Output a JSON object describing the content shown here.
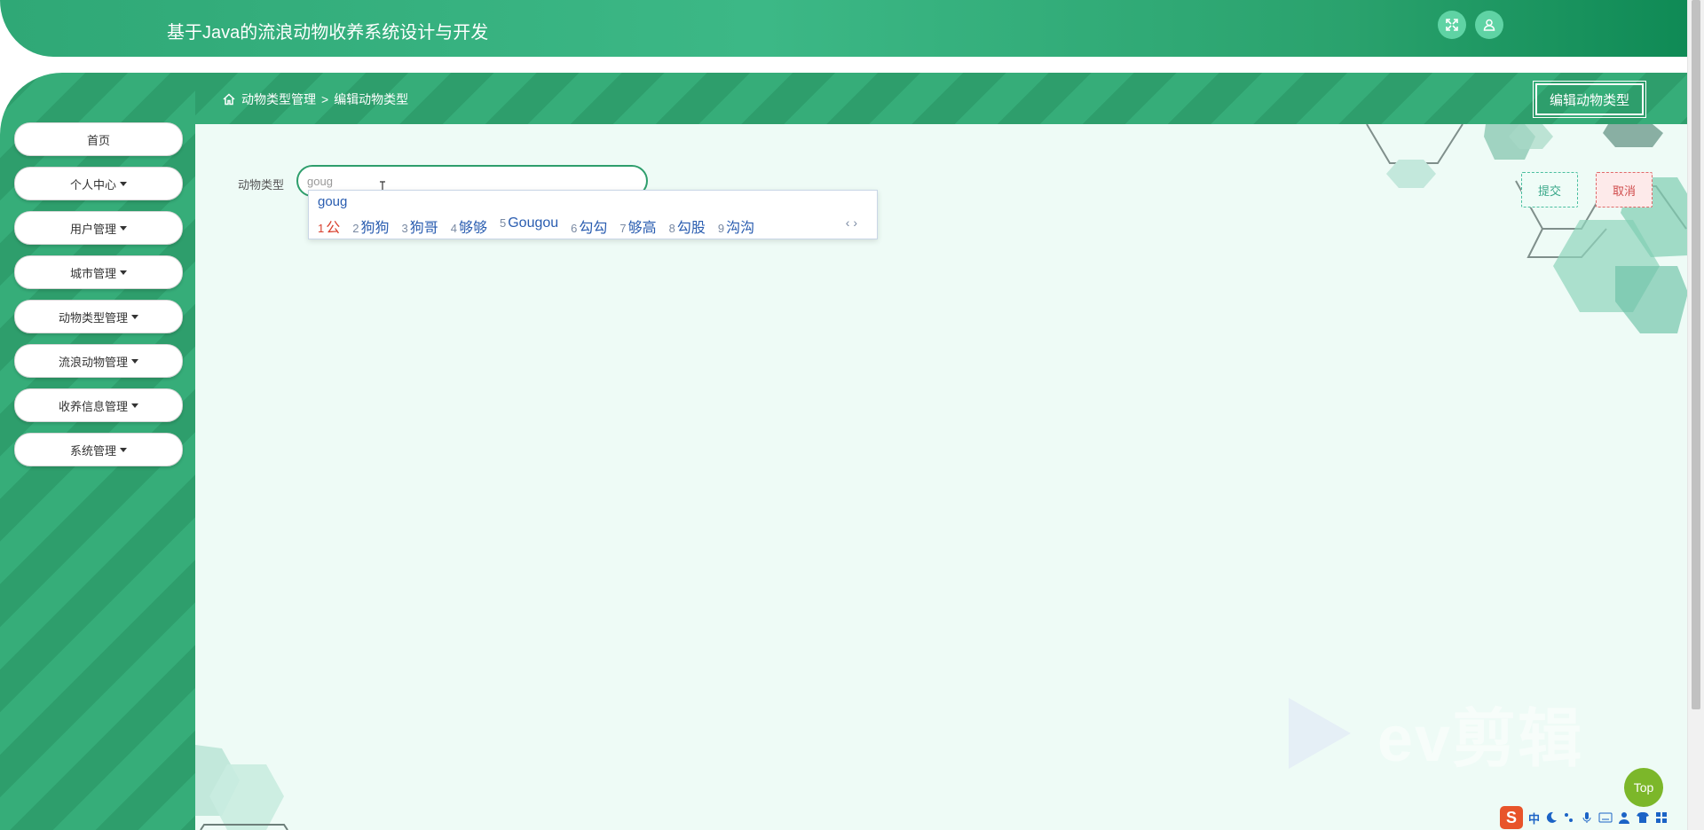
{
  "header": {
    "title": "基于Java的流浪动物收养系统设计与开发",
    "icons": [
      "fullscreen-icon",
      "user-icon"
    ]
  },
  "sidebar": {
    "items": [
      {
        "label": "首页",
        "has_caret": false
      },
      {
        "label": "个人中心",
        "has_caret": true
      },
      {
        "label": "用户管理",
        "has_caret": true
      },
      {
        "label": "城市管理",
        "has_caret": true
      },
      {
        "label": "动物类型管理",
        "has_caret": true
      },
      {
        "label": "流浪动物管理",
        "has_caret": true
      },
      {
        "label": "收养信息管理",
        "has_caret": true
      },
      {
        "label": "系统管理",
        "has_caret": true
      }
    ]
  },
  "breadcrumb": {
    "parent": "动物类型管理",
    "separator": ">",
    "current": "编辑动物类型"
  },
  "page_title": "编辑动物类型",
  "form": {
    "field_label": "动物类型",
    "field_value": "goug",
    "submit_label": "提交",
    "cancel_label": "取消"
  },
  "ime": {
    "pinyin": "goug",
    "candidates": [
      {
        "num": "1",
        "text": "公"
      },
      {
        "num": "2",
        "text": "狗狗"
      },
      {
        "num": "3",
        "text": "狗哥"
      },
      {
        "num": "4",
        "text": "够够"
      },
      {
        "num": "5",
        "text": "Gougou"
      },
      {
        "num": "6",
        "text": "勾勾"
      },
      {
        "num": "7",
        "text": "够高"
      },
      {
        "num": "8",
        "text": "勾股"
      },
      {
        "num": "9",
        "text": "沟沟"
      }
    ],
    "nav": "‹ ›"
  },
  "watermark": {
    "text": "ev剪辑"
  },
  "top_button": {
    "label": "Top"
  },
  "tray": {
    "lang": "中"
  },
  "colors": {
    "primary_green": "#2e9e6c",
    "content_bg": "#eefbf6",
    "submit": "#3aa88a",
    "cancel": "#d04c4c",
    "top_button": "#7cb72a"
  }
}
